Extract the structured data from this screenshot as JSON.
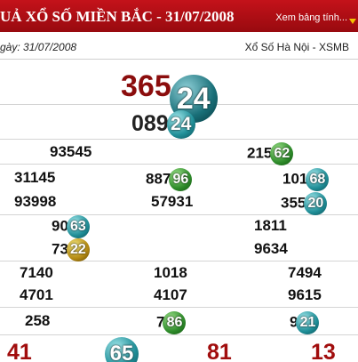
{
  "header": {
    "title": "UẢ XỔ SỐ MIỀN BẮC - 31/07/2008",
    "link": "Xem bảng tính..."
  },
  "info": {
    "date_label": "gày: 31/07/2008",
    "lottery": "Xổ Số Hà Nội - XSMB"
  },
  "special": {
    "main": "365",
    "ball": "24"
  },
  "first": {
    "main": "089",
    "ball": "24"
  },
  "second": [
    {
      "main": "93545",
      "ball": ""
    },
    {
      "main": "215",
      "ball": "62"
    }
  ],
  "third": [
    {
      "main": "31145",
      "ball": ""
    },
    {
      "main": "887",
      "ball": "96"
    },
    {
      "main": "101",
      "ball": "68"
    },
    {
      "main": "93998",
      "ball": ""
    },
    {
      "main": "57931",
      "ball": ""
    },
    {
      "main": "355",
      "ball": "20"
    }
  ],
  "fourth": [
    {
      "main": "90",
      "ball": "63"
    },
    {
      "main": "1811",
      "ball": ""
    },
    {
      "main": "73",
      "ball": "22"
    },
    {
      "main": "9634",
      "ball": ""
    }
  ],
  "fifth": [
    {
      "main": "7140",
      "ball": ""
    },
    {
      "main": "1018",
      "ball": ""
    },
    {
      "main": "7494",
      "ball": ""
    },
    {
      "main": "4701",
      "ball": ""
    },
    {
      "main": "4107",
      "ball": ""
    },
    {
      "main": "9615",
      "ball": ""
    }
  ],
  "sixth": [
    {
      "main": "258",
      "ball": ""
    },
    {
      "main": "7",
      "ball": "86"
    },
    {
      "main": "9",
      "ball": "21"
    }
  ],
  "seventh": [
    {
      "main": "41",
      "ball": ""
    },
    {
      "main": "",
      "ball": "65"
    },
    {
      "main": "81",
      "ball": ""
    },
    {
      "main": "13",
      "ball": ""
    }
  ]
}
